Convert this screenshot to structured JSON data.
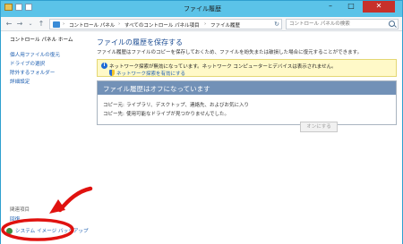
{
  "window": {
    "title": "ファイル履歴"
  },
  "address": {
    "crumbs": [
      "コントロール パネル",
      "すべてのコントロール パネル項目",
      "ファイル履歴"
    ],
    "separator": "›",
    "search_placeholder": "コントロール パネルの検索"
  },
  "sidebar": {
    "home": "コントロール パネル ホーム",
    "items": [
      {
        "label": "個人用ファイルの復元"
      },
      {
        "label": "ドライブの選択"
      },
      {
        "label": "除外するフォルダー"
      },
      {
        "label": "詳細設定"
      }
    ],
    "see_also": "関連項目",
    "see_also_items": [
      {
        "label": "回復"
      },
      {
        "label": "システム イメージ バックアップ"
      }
    ]
  },
  "main": {
    "heading": "ファイルの履歴を保存する",
    "description": "ファイル履歴はファイルのコピーを保存しておくため、ファイルを紛失または破損した場合に復元することができます。",
    "notice": {
      "text": "ネットワーク探索が無効になっています。ネットワーク コンピューターとデバイスは表示されません。",
      "link": "ネットワーク探索を有効にする"
    },
    "status": {
      "title": "ファイル履歴はオフになっています",
      "rows": [
        {
          "label": "コピー元:",
          "value": "ライブラリ、デスクトップ、連絡先、およびお気に入り"
        },
        {
          "label": "コピー先:",
          "value": "使用可能なドライブが見つかりませんでした。"
        }
      ]
    },
    "turn_on_button": "オンにする"
  },
  "colors": {
    "frame": "#5bc3e8",
    "link": "#1e5fb1",
    "heading": "#1e4e94",
    "status_header": "#7291b7",
    "notice_bg": "#fff9c8",
    "annotation": "#e0120f"
  }
}
